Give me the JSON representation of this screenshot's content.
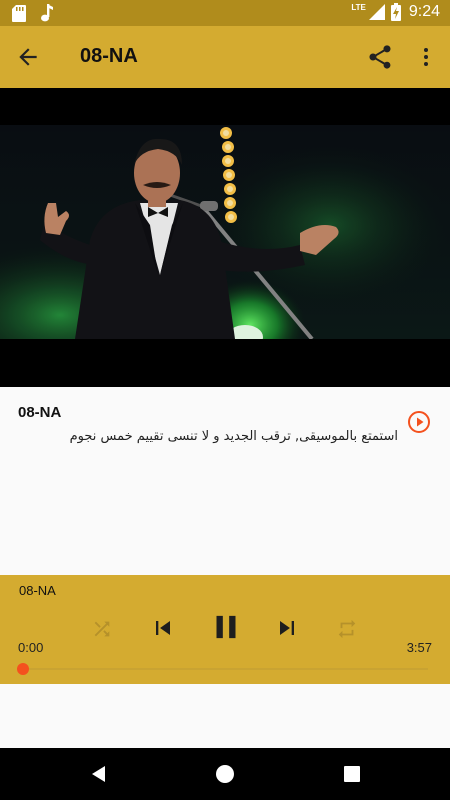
{
  "status_bar": {
    "time": "9:24",
    "network": "LTE",
    "icons": [
      "sd-card-icon",
      "music-note-icon",
      "signal-icon",
      "battery-charging-icon"
    ]
  },
  "app_bar": {
    "title": "08-NA",
    "icons": [
      "arrow-back-icon",
      "share-icon",
      "more-vert-icon"
    ]
  },
  "track": {
    "title": "08-NA",
    "description": "استمتع بالموسيقى, ترقب الجديد و لا تنسى تقييم خمس نجوم"
  },
  "player": {
    "title": "08-NA",
    "current_time": "0:00",
    "total_time": "3:57",
    "progress_fraction": 0,
    "icons": [
      "shuffle-icon",
      "skip-previous-icon",
      "pause-icon",
      "skip-next-icon",
      "repeat-icon"
    ]
  },
  "nav_bar": {
    "icons": [
      "back-triangle-icon",
      "home-circle-icon",
      "recents-square-icon"
    ]
  },
  "colors": {
    "status_bar": "#b08c1c",
    "app_bar": "#d4ab30",
    "player_bar": "#d4ab30",
    "accent": "#f4511e"
  }
}
